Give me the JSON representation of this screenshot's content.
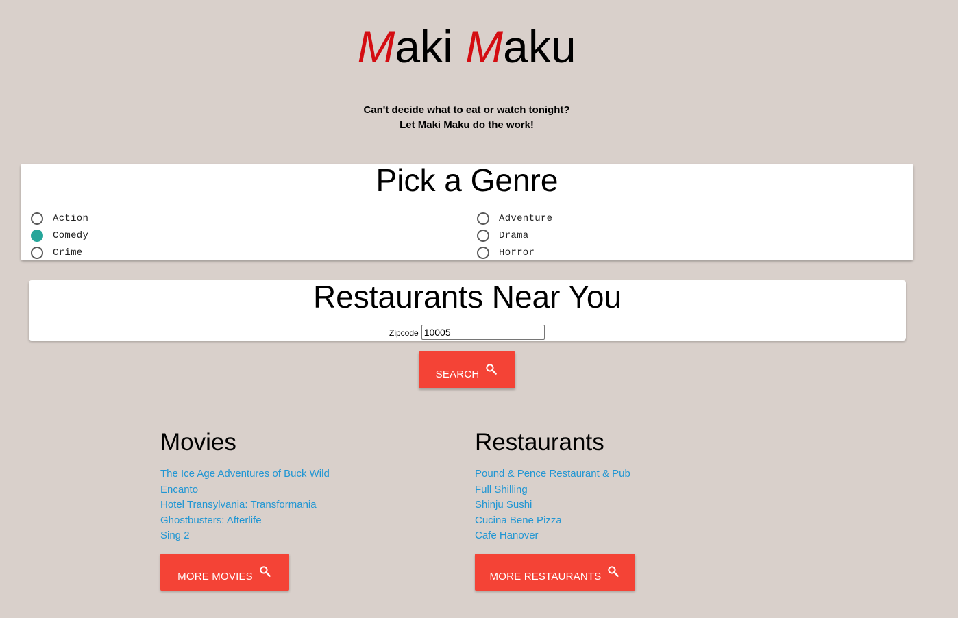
{
  "header": {
    "logo_cap_1": "M",
    "logo_rest_1": "aki",
    "logo_cap_2": "M",
    "logo_rest_2": "aku",
    "tagline_line1": "Can't decide what to eat or watch tonight?",
    "tagline_line2": "Let Maki Maku do the work!"
  },
  "genre": {
    "title": "Pick a Genre",
    "options_left": [
      {
        "label": "Action",
        "checked": false
      },
      {
        "label": "Comedy",
        "checked": true
      },
      {
        "label": "Crime",
        "checked": false
      }
    ],
    "options_right": [
      {
        "label": "Adventure",
        "checked": false
      },
      {
        "label": "Drama",
        "checked": false
      },
      {
        "label": "Horror",
        "checked": false
      }
    ],
    "selected": "Comedy"
  },
  "restaurants_form": {
    "title": "Restaurants Near You",
    "zip_label": "Zipcode",
    "zip_value": "10005"
  },
  "search_button": {
    "label": "Search",
    "icon": "search-icon"
  },
  "movies": {
    "heading": "Movies",
    "items": [
      "The Ice Age Adventures of Buck Wild",
      "Encanto",
      "Hotel Transylvania: Transformania",
      "Ghostbusters: Afterlife",
      "Sing 2"
    ],
    "more_label": "More Movies"
  },
  "restaurants": {
    "heading": "Restaurants",
    "items": [
      "Pound & Pence Restaurant & Pub",
      "Full Shilling",
      "Shinju Sushi",
      "Cucina Bene Pizza",
      "Cafe Hanover"
    ],
    "more_label": "More Restaurants"
  },
  "colors": {
    "background": "#d9d0cb",
    "logo_accent": "#d40d12",
    "button": "#f44336",
    "link": "#2196d3",
    "radio_checked": "#26a69a"
  }
}
